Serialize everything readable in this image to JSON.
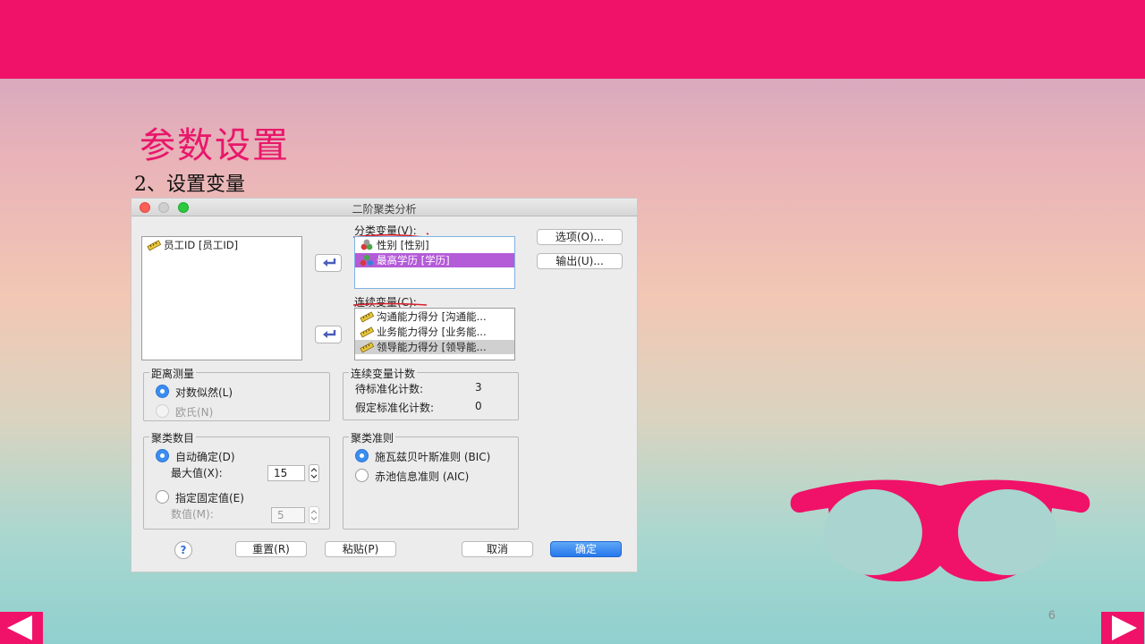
{
  "slide": {
    "title": "参数设置",
    "subtitle": "2、设置变量",
    "page_number": "6"
  },
  "dialog": {
    "title": "二阶聚类分析",
    "source_list": [
      {
        "label": "员工ID [员工ID]",
        "icon": "scale-ruler-icon"
      }
    ],
    "categorical_label": "分类变量(V):",
    "categorical_list": [
      {
        "label": "性别 [性别]",
        "icon": "nominal-icon"
      },
      {
        "label": "最高学历 [学历]",
        "icon": "ordinal-icon",
        "selected": true
      }
    ],
    "continuous_label": "连续变量(C):",
    "continuous_list": [
      {
        "label": "沟通能力得分 [沟通能...",
        "icon": "scale-ruler-icon"
      },
      {
        "label": "业务能力得分 [业务能...",
        "icon": "scale-ruler-icon"
      },
      {
        "label": "领导能力得分 [领导能...",
        "icon": "scale-ruler-icon",
        "selected": true
      }
    ],
    "options_button": "选项(O)...",
    "output_button": "输出(U)...",
    "distance": {
      "title": "距离测量",
      "opt_loglik": "对数似然(L)",
      "opt_euclid": "欧氏(N)",
      "selected": "对数似然(L)"
    },
    "continuous_count": {
      "title": "连续变量计数",
      "standardize_label": "待标准化计数:",
      "standardize_value": "3",
      "assumed_label": "假定标准化计数:",
      "assumed_value": "0"
    },
    "clusters": {
      "title": "聚类数目",
      "opt_auto": "自动确定(D)",
      "max_label": "最大值(X):",
      "max_value": "15",
      "opt_fixed": "指定固定值(E)",
      "count_label": "数值(M):",
      "count_value": "5",
      "selected": "自动确定(D)"
    },
    "criterion": {
      "title": "聚类准则",
      "opt_bic": "施瓦兹贝叶斯准则 (BIC)",
      "opt_aic": "赤池信息准则 (AIC)",
      "selected": "施瓦兹贝叶斯准则 (BIC)"
    },
    "buttons": {
      "help": "?",
      "reset": "重置(R)",
      "paste": "粘贴(P)",
      "cancel": "取消",
      "ok": "确定"
    }
  },
  "colors": {
    "brand_pink": "#ef1268",
    "title_pink": "#e9166a",
    "selection_purple": "#b45bd8",
    "mac_blue": "#2677ec"
  }
}
